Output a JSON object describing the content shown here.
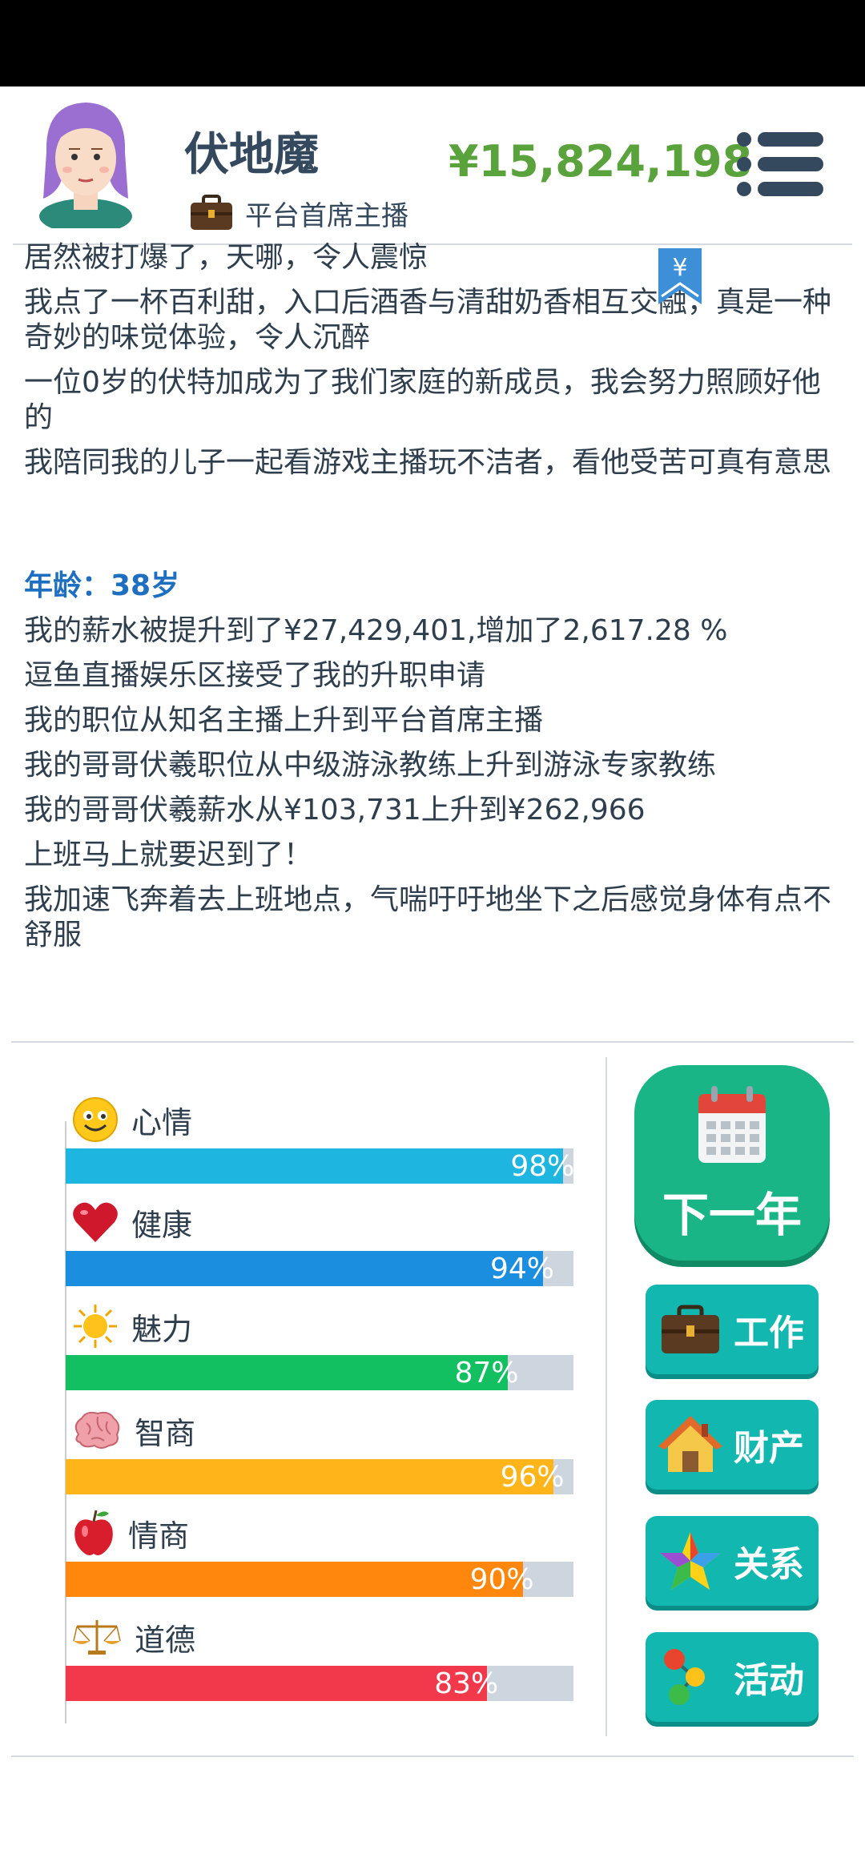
{
  "player": {
    "name": "伏地魔",
    "job_title": "平台首席主播",
    "money": "¥15,824,198"
  },
  "log": {
    "entries_before": [
      "居然被打爆了，天哪，令人震惊",
      "我点了一杯百利甜，入口后酒香与清甜奶香相互交融，真是一种奇妙的味觉体验，令人沉醉",
      "一位0岁的伏特加成为了我们家庭的新成员，我会努力照顾好他的",
      "我陪同我的儿子一起看游戏主播玩不洁者，看他受苦可真有意思"
    ],
    "age_label": "年龄：38岁",
    "entries_after": [
      "我的薪水被提升到了¥27,429,401,增加了2,617.28 %",
      "逗鱼直播娱乐区接受了我的升职申请",
      "我的职位从知名主播上升到平台首席主播",
      "我的哥哥伏羲职位从中级游泳教练上升到游泳专家教练",
      "我的哥哥伏羲薪水从¥103,731上升到¥262,966",
      "上班马上就要迟到了！",
      "我加速飞奔着去上班地点，气喘吁吁地坐下之后感觉身体有点不舒服"
    ],
    "bookmark_symbol": "¥"
  },
  "stats": [
    {
      "label": "心情",
      "value": 98,
      "display": "98%",
      "color": "#1eb6e0",
      "icon": "smiley-icon"
    },
    {
      "label": "健康",
      "value": 94,
      "display": "94%",
      "color": "#1c8ee0",
      "icon": "heart-icon"
    },
    {
      "label": "魅力",
      "value": 87,
      "display": "87%",
      "color": "#12c061",
      "icon": "sun-icon"
    },
    {
      "label": "智商",
      "value": 96,
      "display": "96%",
      "color": "#ffb41a",
      "icon": "brain-icon"
    },
    {
      "label": "情商",
      "value": 90,
      "display": "90%",
      "color": "#ff870e",
      "icon": "apple-icon"
    },
    {
      "label": "道德",
      "value": 83,
      "display": "83%",
      "color": "#f2394b",
      "icon": "scales-icon"
    }
  ],
  "buttons": {
    "next_year": "下一年",
    "work": "工作",
    "property": "财产",
    "relations": "关系",
    "activities": "活动"
  },
  "colors": {
    "money": "#5aa23c",
    "age": "#1e6fbf",
    "next_year_bg": "#1ab586",
    "side_button_bg": "#12b7b0"
  }
}
